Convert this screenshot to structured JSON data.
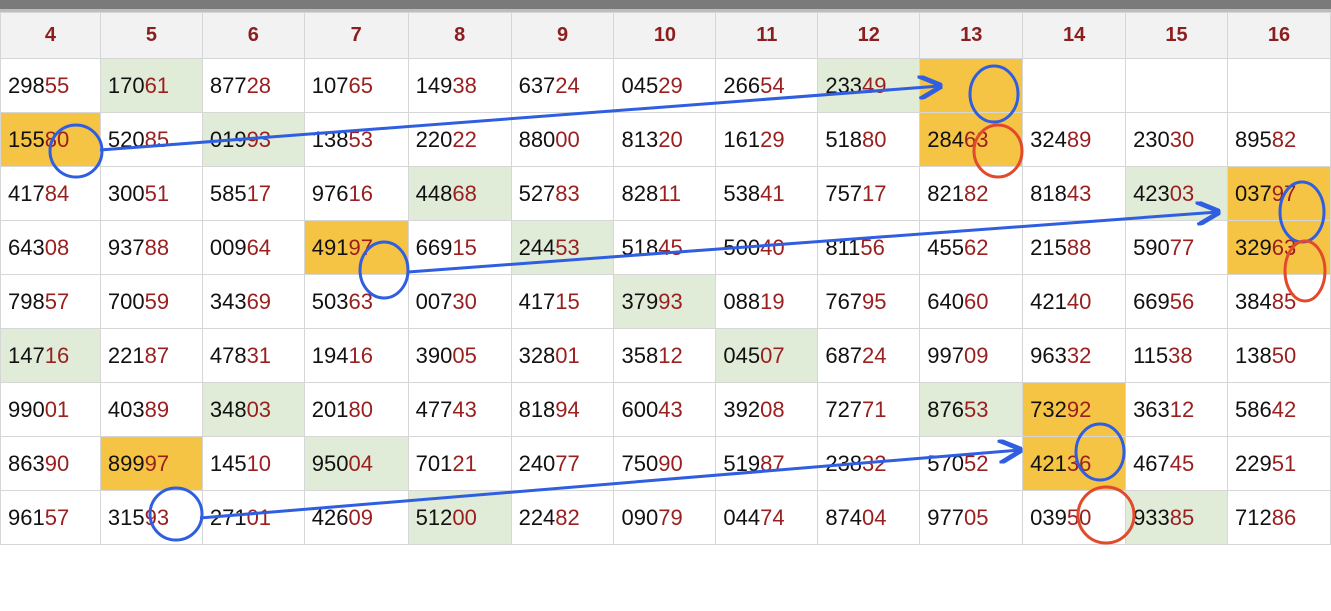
{
  "header": [
    "4",
    "5",
    "6",
    "7",
    "8",
    "9",
    "10",
    "11",
    "12",
    "13",
    "14",
    "15",
    "16"
  ],
  "rows": [
    [
      {
        "h": "298",
        "t": "55"
      },
      {
        "h": "170",
        "t": "61",
        "c": "g"
      },
      {
        "h": "877",
        "t": "28"
      },
      {
        "h": "107",
        "t": "65"
      },
      {
        "h": "149",
        "t": "38"
      },
      {
        "h": "637",
        "t": "24"
      },
      {
        "h": "045",
        "t": "29"
      },
      {
        "h": "266",
        "t": "54"
      },
      {
        "h": "233",
        "t": "49",
        "c": "g"
      },
      {
        "h": "",
        "t": "",
        "c": "y"
      },
      {
        "h": "",
        "t": ""
      },
      {
        "h": "",
        "t": ""
      },
      {
        "h": "",
        "t": ""
      }
    ],
    [
      {
        "h": "155",
        "t": "80",
        "c": "y"
      },
      {
        "h": "520",
        "t": "85"
      },
      {
        "h": "019",
        "t": "93",
        "c": "g"
      },
      {
        "h": "138",
        "t": "53"
      },
      {
        "h": "220",
        "t": "22"
      },
      {
        "h": "880",
        "t": "00"
      },
      {
        "h": "813",
        "t": "20"
      },
      {
        "h": "161",
        "t": "29"
      },
      {
        "h": "518",
        "t": "80"
      },
      {
        "h": "284",
        "t": "63",
        "c": "y"
      },
      {
        "h": "324",
        "t": "89"
      },
      {
        "h": "230",
        "t": "30"
      },
      {
        "h": "895",
        "t": "82"
      }
    ],
    [
      {
        "h": "417",
        "t": "84"
      },
      {
        "h": "300",
        "t": "51"
      },
      {
        "h": "585",
        "t": "17"
      },
      {
        "h": "976",
        "t": "16"
      },
      {
        "h": "448",
        "t": "68",
        "c": "g"
      },
      {
        "h": "527",
        "t": "83"
      },
      {
        "h": "828",
        "t": "11"
      },
      {
        "h": "538",
        "t": "41"
      },
      {
        "h": "757",
        "t": "17"
      },
      {
        "h": "821",
        "t": "82"
      },
      {
        "h": "818",
        "t": "43"
      },
      {
        "h": "423",
        "t": "03",
        "c": "g"
      },
      {
        "h": "037",
        "t": "97",
        "c": "y"
      }
    ],
    [
      {
        "h": "643",
        "t": "08"
      },
      {
        "h": "937",
        "t": "88"
      },
      {
        "h": "009",
        "t": "64"
      },
      {
        "h": "491",
        "t": "97",
        "c": "y"
      },
      {
        "h": "669",
        "t": "15"
      },
      {
        "h": "244",
        "t": "53",
        "c": "g"
      },
      {
        "h": "518",
        "t": "45"
      },
      {
        "h": "500",
        "t": "40"
      },
      {
        "h": "811",
        "t": "56"
      },
      {
        "h": "455",
        "t": "62"
      },
      {
        "h": "215",
        "t": "88"
      },
      {
        "h": "590",
        "t": "77"
      },
      {
        "h": "329",
        "t": "63",
        "c": "y"
      }
    ],
    [
      {
        "h": "798",
        "t": "57"
      },
      {
        "h": "700",
        "t": "59"
      },
      {
        "h": "343",
        "t": "69"
      },
      {
        "h": "503",
        "t": "63"
      },
      {
        "h": "007",
        "t": "30"
      },
      {
        "h": "417",
        "t": "15"
      },
      {
        "h": "379",
        "t": "93",
        "c": "g"
      },
      {
        "h": "088",
        "t": "19"
      },
      {
        "h": "767",
        "t": "95"
      },
      {
        "h": "640",
        "t": "60"
      },
      {
        "h": "421",
        "t": "40"
      },
      {
        "h": "669",
        "t": "56"
      },
      {
        "h": "384",
        "t": "85"
      }
    ],
    [
      {
        "h": "147",
        "t": "16",
        "c": "g"
      },
      {
        "h": "221",
        "t": "87"
      },
      {
        "h": "478",
        "t": "31"
      },
      {
        "h": "194",
        "t": "16"
      },
      {
        "h": "390",
        "t": "05"
      },
      {
        "h": "328",
        "t": "01"
      },
      {
        "h": "358",
        "t": "12"
      },
      {
        "h": "045",
        "t": "07",
        "c": "g"
      },
      {
        "h": "687",
        "t": "24"
      },
      {
        "h": "997",
        "t": "09"
      },
      {
        "h": "963",
        "t": "32"
      },
      {
        "h": "115",
        "t": "38"
      },
      {
        "h": "138",
        "t": "50"
      }
    ],
    [
      {
        "h": "990",
        "t": "01"
      },
      {
        "h": "403",
        "t": "89"
      },
      {
        "h": "348",
        "t": "03",
        "c": "g"
      },
      {
        "h": "201",
        "t": "80"
      },
      {
        "h": "477",
        "t": "43"
      },
      {
        "h": "818",
        "t": "94"
      },
      {
        "h": "600",
        "t": "43"
      },
      {
        "h": "392",
        "t": "08"
      },
      {
        "h": "727",
        "t": "71"
      },
      {
        "h": "876",
        "t": "53",
        "c": "g"
      },
      {
        "h": "732",
        "t": "92",
        "c": "y"
      },
      {
        "h": "363",
        "t": "12"
      },
      {
        "h": "586",
        "t": "42"
      }
    ],
    [
      {
        "h": "863",
        "t": "90"
      },
      {
        "h": "899",
        "t": "97",
        "c": "y"
      },
      {
        "h": "145",
        "t": "10"
      },
      {
        "h": "950",
        "t": "04",
        "c": "g"
      },
      {
        "h": "701",
        "t": "21"
      },
      {
        "h": "240",
        "t": "77"
      },
      {
        "h": "750",
        "t": "90"
      },
      {
        "h": "519",
        "t": "87"
      },
      {
        "h": "238",
        "t": "32"
      },
      {
        "h": "570",
        "t": "52"
      },
      {
        "h": "421",
        "t": "36",
        "c": "y"
      },
      {
        "h": "467",
        "t": "45"
      },
      {
        "h": "229",
        "t": "51"
      }
    ],
    [
      {
        "h": "961",
        "t": "57"
      },
      {
        "h": "315",
        "t": "93"
      },
      {
        "h": "271",
        "t": "01"
      },
      {
        "h": "426",
        "t": "09"
      },
      {
        "h": "512",
        "t": "00",
        "c": "g"
      },
      {
        "h": "224",
        "t": "82"
      },
      {
        "h": "090",
        "t": "79"
      },
      {
        "h": "044",
        "t": "74"
      },
      {
        "h": "874",
        "t": "04"
      },
      {
        "h": "977",
        "t": "05"
      },
      {
        "h": "039",
        "t": "50"
      },
      {
        "h": "933",
        "t": "85",
        "c": "g"
      },
      {
        "h": "712",
        "t": "86"
      }
    ]
  ]
}
